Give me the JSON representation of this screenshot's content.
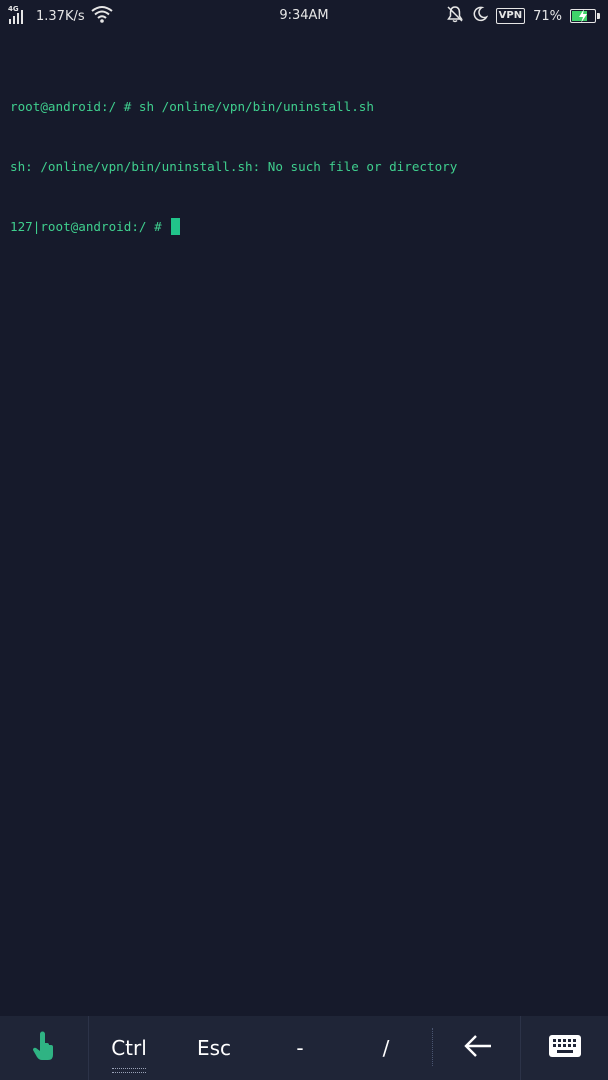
{
  "status_bar": {
    "network_type": "4G",
    "net_speed": "1.37K/s",
    "time": "9:34AM",
    "vpn_label": "VPN",
    "battery_percent": "71%",
    "battery_level": 0.71,
    "icons": [
      "signal-icon",
      "wifi-icon",
      "alarm-off-icon",
      "moon-icon",
      "vpn-icon",
      "battery-charging-icon"
    ]
  },
  "terminal": {
    "lines": [
      "root@android:/ # sh /online/vpn/bin/uninstall.sh",
      "sh: /online/vpn/bin/uninstall.sh: No such file or directory"
    ],
    "prompt_code": "127",
    "prompt_sep": "|",
    "prompt": "root@android:/ # ",
    "text_color": "#3fcf8e",
    "background": "#161a2b"
  },
  "keybar": {
    "keys": [
      {
        "label": "",
        "icon": "touch-hand-icon"
      },
      {
        "label": "Ctrl"
      },
      {
        "label": "Esc"
      },
      {
        "label": "-"
      },
      {
        "label": "/"
      },
      {
        "label": "",
        "icon": "arrow-left-icon"
      },
      {
        "label": "",
        "icon": "keyboard-icon"
      }
    ]
  }
}
